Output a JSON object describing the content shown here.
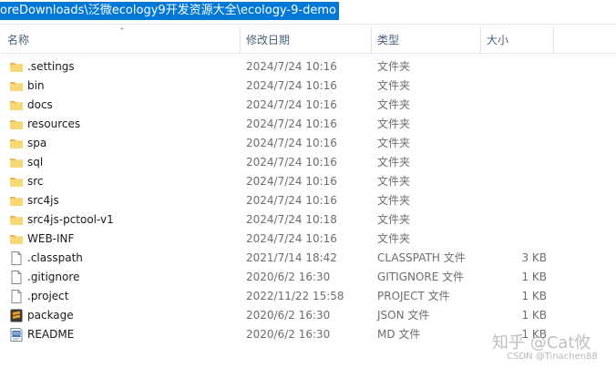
{
  "address": {
    "path": "oreDownloads\\泛微ecology9开发资源大全\\ecology-9-demo"
  },
  "columns": {
    "name": "名称",
    "date": "修改日期",
    "type": "类型",
    "size": "大小"
  },
  "files": [
    {
      "name": ".settings",
      "date": "2024/7/24 10:16",
      "type": "文件夹",
      "size": "",
      "icon": "folder-icon"
    },
    {
      "name": "bin",
      "date": "2024/7/24 10:16",
      "type": "文件夹",
      "size": "",
      "icon": "folder-icon"
    },
    {
      "name": "docs",
      "date": "2024/7/24 10:16",
      "type": "文件夹",
      "size": "",
      "icon": "folder-icon"
    },
    {
      "name": "resources",
      "date": "2024/7/24 10:16",
      "type": "文件夹",
      "size": "",
      "icon": "folder-icon"
    },
    {
      "name": "spa",
      "date": "2024/7/24 10:16",
      "type": "文件夹",
      "size": "",
      "icon": "folder-icon"
    },
    {
      "name": "sql",
      "date": "2024/7/24 10:16",
      "type": "文件夹",
      "size": "",
      "icon": "folder-icon"
    },
    {
      "name": "src",
      "date": "2024/7/24 10:16",
      "type": "文件夹",
      "size": "",
      "icon": "folder-icon"
    },
    {
      "name": "src4js",
      "date": "2024/7/24 10:16",
      "type": "文件夹",
      "size": "",
      "icon": "folder-icon"
    },
    {
      "name": "src4js-pctool-v1",
      "date": "2024/7/24 10:18",
      "type": "文件夹",
      "size": "",
      "icon": "folder-icon"
    },
    {
      "name": "WEB-INF",
      "date": "2024/7/24 10:16",
      "type": "文件夹",
      "size": "",
      "icon": "folder-icon"
    },
    {
      "name": ".classpath",
      "date": "2021/7/14 18:42",
      "type": "CLASSPATH 文件",
      "size": "3 KB",
      "icon": "file-icon"
    },
    {
      "name": ".gitignore",
      "date": "2020/6/2 16:30",
      "type": "GITIGNORE 文件",
      "size": "1 KB",
      "icon": "file-icon"
    },
    {
      "name": ".project",
      "date": "2022/11/22 15:58",
      "type": "PROJECT 文件",
      "size": "1 KB",
      "icon": "file-icon"
    },
    {
      "name": "package",
      "date": "2020/6/2 16:30",
      "type": "JSON 文件",
      "size": "1 KB",
      "icon": "sublime-file-icon"
    },
    {
      "name": "README",
      "date": "2020/6/2 16:30",
      "type": "MD 文件",
      "size": "1 KB",
      "icon": "markdown-file-icon"
    }
  ],
  "watermark": {
    "text": "知乎 @Cat攸",
    "sub": "CSDN @Tinachen88"
  },
  "colors": {
    "selection": "#0078d7",
    "folder": "#f8d775",
    "header_text": "#4c607a"
  }
}
